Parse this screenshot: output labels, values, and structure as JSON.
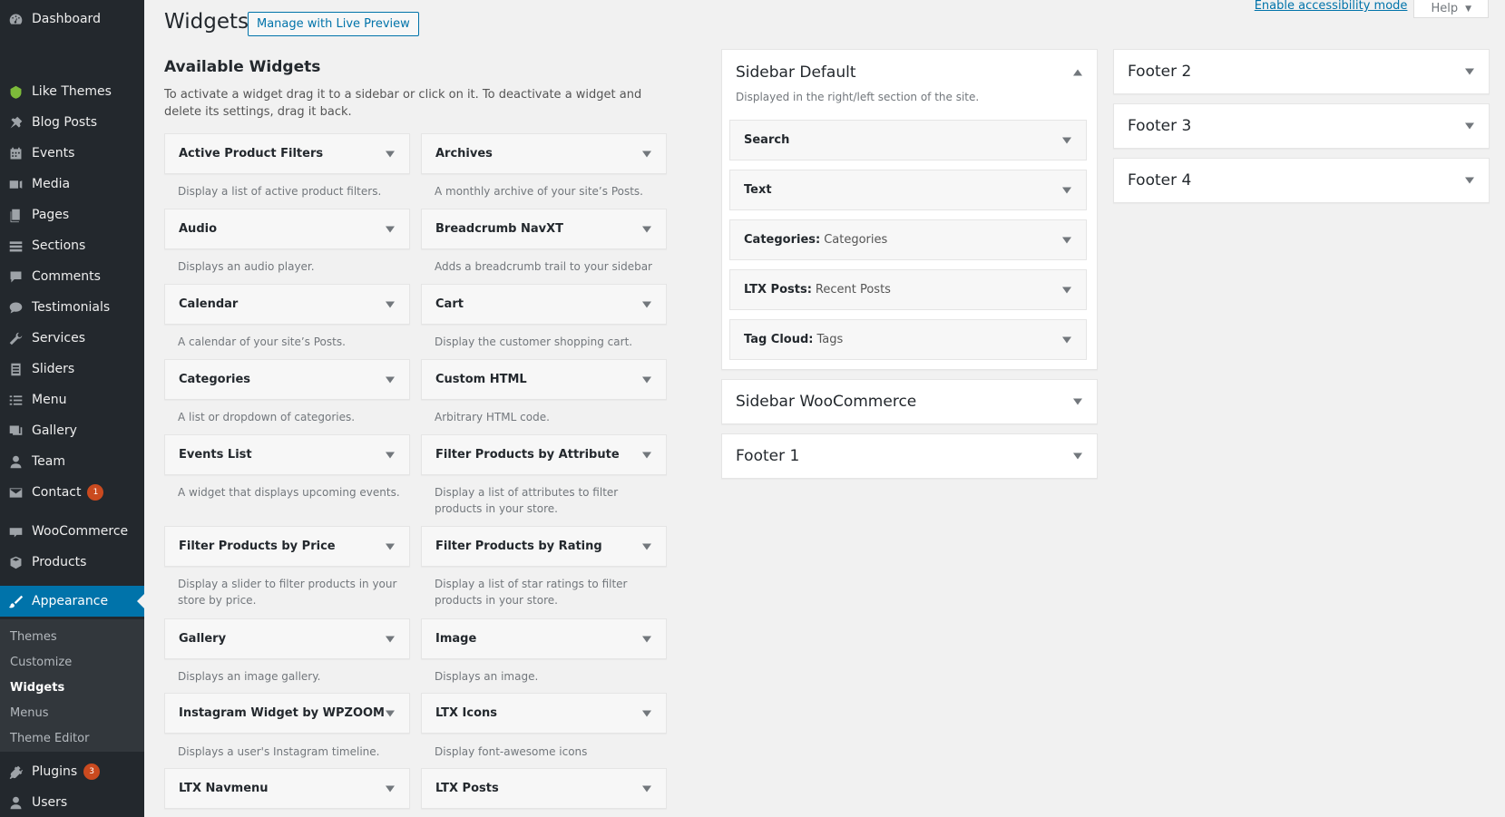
{
  "menu": [
    {
      "label": "Dashboard",
      "icon": "dashboard-icon",
      "name": "menu-dashboard"
    },
    {
      "label": "Like Themes",
      "icon": "like-themes-icon",
      "name": "menu-like-themes"
    },
    {
      "label": "Blog Posts",
      "icon": "pushpin-icon",
      "name": "menu-blog-posts"
    },
    {
      "label": "Events",
      "icon": "calendar-icon",
      "name": "menu-events"
    },
    {
      "label": "Media",
      "icon": "media-icon",
      "name": "menu-media"
    },
    {
      "label": "Pages",
      "icon": "pages-icon",
      "name": "menu-pages"
    },
    {
      "label": "Sections",
      "icon": "sections-icon",
      "name": "menu-sections"
    },
    {
      "label": "Comments",
      "icon": "comment-icon",
      "name": "menu-comments"
    },
    {
      "label": "Testimonials",
      "icon": "testimonial-icon",
      "name": "menu-testimonials"
    },
    {
      "label": "Services",
      "icon": "wrench-icon",
      "name": "menu-services"
    },
    {
      "label": "Sliders",
      "icon": "slides-icon",
      "name": "menu-sliders"
    },
    {
      "label": "Menu",
      "icon": "list-icon",
      "name": "menu-menu"
    },
    {
      "label": "Gallery",
      "icon": "gallery-icon",
      "name": "menu-gallery"
    },
    {
      "label": "Team",
      "icon": "user-icon",
      "name": "menu-team"
    },
    {
      "label": "Contact",
      "icon": "mail-icon",
      "name": "menu-contact",
      "badge": "1"
    },
    {
      "label": "WooCommerce",
      "icon": "woocommerce-icon",
      "name": "menu-woocommerce"
    },
    {
      "label": "Products",
      "icon": "box-icon",
      "name": "menu-products"
    },
    {
      "label": "Appearance",
      "icon": "brush-icon",
      "name": "menu-appearance"
    },
    {
      "label": "Plugins",
      "icon": "plugin-icon",
      "name": "menu-plugins",
      "badge": "3"
    },
    {
      "label": "Users",
      "icon": "users-icon",
      "name": "menu-users"
    }
  ],
  "submenu": [
    "Themes",
    "Customize",
    "Widgets",
    "Menus",
    "Theme Editor"
  ],
  "top": {
    "accessibility": "Enable accessibility mode",
    "help": "Help"
  },
  "page": {
    "title": "Widgets",
    "manage_button": "Manage with Live Preview",
    "available_title": "Available Widgets",
    "available_desc": "To activate a widget drag it to a sidebar or click on it. To deactivate a widget and delete its settings, drag it back."
  },
  "widgets_left": [
    {
      "title": "Active Product Filters",
      "desc": "Display a list of active product filters."
    },
    {
      "title": "Audio",
      "desc": "Displays an audio player."
    },
    {
      "title": "Calendar",
      "desc": "A calendar of your site’s Posts."
    },
    {
      "title": "Categories",
      "desc": "A list or dropdown of categories."
    },
    {
      "title": "Events List",
      "desc": "A widget that displays upcoming events."
    },
    {
      "title": "Filter Products by Price",
      "desc": "Display a slider to filter products in your store by price."
    },
    {
      "title": "Gallery",
      "desc": "Displays an image gallery."
    },
    {
      "title": "Instagram Widget by WPZOOM",
      "desc": "Displays a user's Instagram timeline."
    },
    {
      "title": "LTX Navmenu",
      "desc": ""
    }
  ],
  "widgets_right": [
    {
      "title": "Archives",
      "desc": "A monthly archive of your site’s Posts."
    },
    {
      "title": "Breadcrumb NavXT",
      "desc": "Adds a breadcrumb trail to your sidebar"
    },
    {
      "title": "Cart",
      "desc": "Display the customer shopping cart."
    },
    {
      "title": "Custom HTML",
      "desc": "Arbitrary HTML code."
    },
    {
      "title": "Filter Products by Attribute",
      "desc": "Display a list of attributes to filter products in your store."
    },
    {
      "title": "Filter Products by Rating",
      "desc": "Display a list of star ratings to filter products in your store."
    },
    {
      "title": "Image",
      "desc": "Displays an image."
    },
    {
      "title": "LTX Icons",
      "desc": "Display font-awesome icons"
    },
    {
      "title": "LTX Posts",
      "desc": ""
    }
  ],
  "sidebars": {
    "default": {
      "title": "Sidebar Default",
      "desc": "Displayed in the right/left section of the site.",
      "items": [
        {
          "title": "Search",
          "sub": ""
        },
        {
          "title": "Text",
          "sub": ""
        },
        {
          "title": "Categories:",
          "sub": "Categories"
        },
        {
          "title": "LTX Posts:",
          "sub": "Recent Posts"
        },
        {
          "title": "Tag Cloud:",
          "sub": "Tags"
        }
      ]
    },
    "woocommerce": {
      "title": "Sidebar WooCommerce"
    },
    "footer1": {
      "title": "Footer 1"
    },
    "footer2": {
      "title": "Footer 2"
    },
    "footer3": {
      "title": "Footer 3"
    },
    "footer4": {
      "title": "Footer 4"
    }
  },
  "colors": {
    "sidebar_bg": "#23282d",
    "accent": "#0073aa",
    "badge": "#ca4a1f"
  }
}
